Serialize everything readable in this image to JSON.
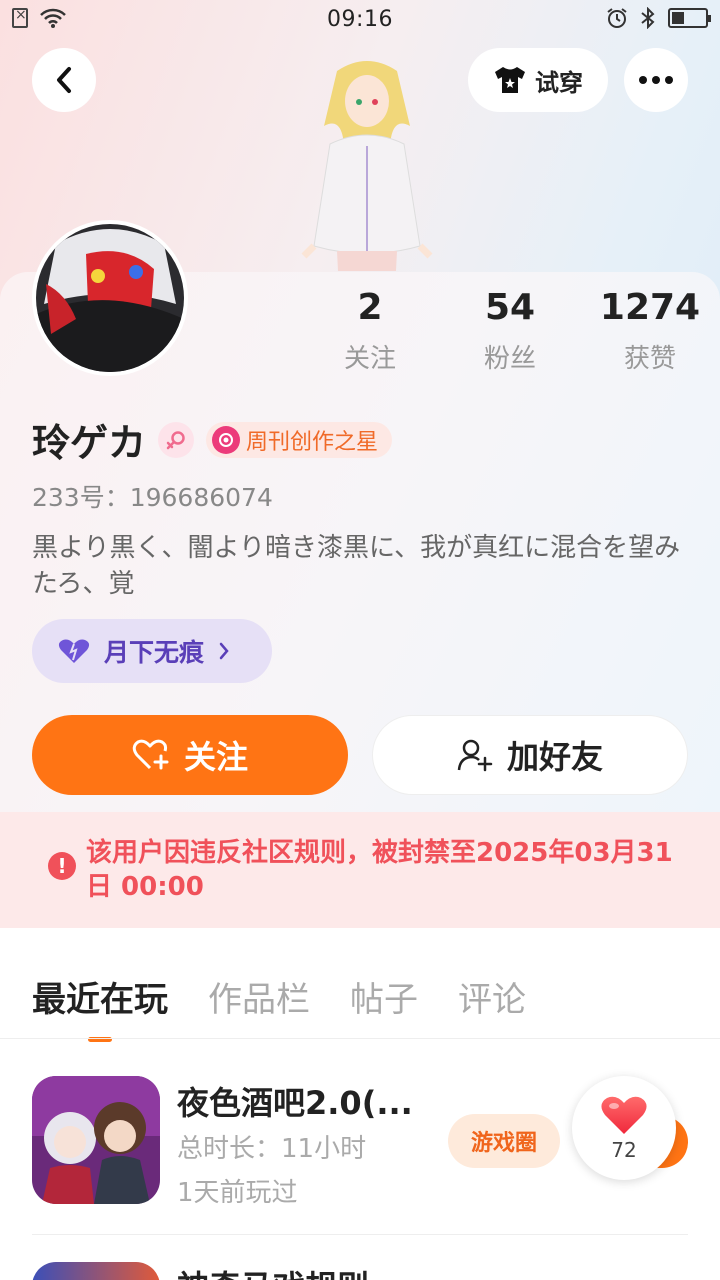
{
  "status_bar": {
    "time": "09:16"
  },
  "header": {
    "tryon_label": "试穿"
  },
  "stats": [
    {
      "value": "2",
      "label": "关注"
    },
    {
      "value": "54",
      "label": "粉丝"
    },
    {
      "value": "1274",
      "label": "获赞"
    }
  ],
  "profile": {
    "username": "玲ゲカ",
    "title_badge": "周刊创作之星",
    "uid": "233号：196686074",
    "bio": "黒より黒く、闇より暗き漆黒に、我が真红に混合を望みたろ、覚",
    "guild": "月下无痕"
  },
  "actions": {
    "follow_label": "关注",
    "add_friend_label": "加好友"
  },
  "ban_notice": "该用户因违反社区规则，被封禁至2025年03月31日 00:00",
  "tabs": [
    "最近在玩",
    "作品栏",
    "帖子",
    "评论"
  ],
  "games": [
    {
      "title": "夜色酒吧2.0(...",
      "duration": "总时长：11小时",
      "last_played": "1天前玩过",
      "circle_label": "游戏圈"
    },
    {
      "title": "神奇马戏规则"
    }
  ],
  "like_count": "72",
  "colors": {
    "accent": "#ff7414",
    "ban_red": "#f0515a",
    "guild_purple": "#5a3fb8"
  }
}
